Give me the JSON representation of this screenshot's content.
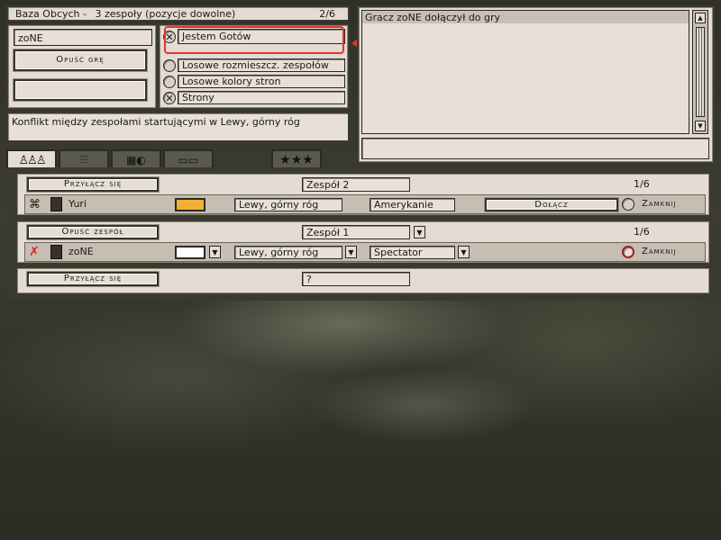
{
  "header": {
    "game_title": "Baza Obcych -",
    "teams_info": "3 zespoły (pozycje dowolne)",
    "player_count": "2/6"
  },
  "player": {
    "name": "zoNE",
    "leave_game_label": "Opuść grę",
    "empty_button_label": ""
  },
  "options": {
    "ready_label": "Jestem Gotów",
    "random_placement_label": "Losowe rozmieszcz. zespołów",
    "random_colors_label": "Losowe kolory stron",
    "sides_label": "Strony"
  },
  "description": "Konflikt między zespołami startującymi w Lewy, górny róg",
  "chat": {
    "messages": [
      "Gracz zoNE dołączył do gry"
    ],
    "input_value": ""
  },
  "tabs": [
    {
      "name": "players-tab",
      "icon": "people-icon"
    },
    {
      "name": "settings-tab",
      "icon": "sliders-icon"
    },
    {
      "name": "map-tab",
      "icon": "map-icon"
    },
    {
      "name": "computers-tab",
      "icon": "computers-icon"
    },
    {
      "name": "rank-tab",
      "icon": "stars-icon"
    }
  ],
  "teams": [
    {
      "action_label": "Przyłącz się",
      "team_name": "Zespół 2",
      "count": "1/6",
      "player": {
        "name": "Yuri",
        "color": "#f0b030",
        "start": "Lewy, górny róg",
        "side": "Amerykanie",
        "join_label": "Dołącz",
        "close_label": "Zamknij"
      }
    },
    {
      "action_label": "Opuść zespół",
      "team_name": "Zespół 1",
      "count": "1/6",
      "player": {
        "name": "zoNE",
        "color": "#ffffff",
        "start": "Lewy, górny róg",
        "side": "Spectator",
        "close_label": "Zamknij"
      }
    },
    {
      "action_label": "Przyłącz się",
      "team_name": "?"
    }
  ],
  "colors": {
    "annotation_red": "#e8332a",
    "panel_bg": "#e4dbd4"
  }
}
